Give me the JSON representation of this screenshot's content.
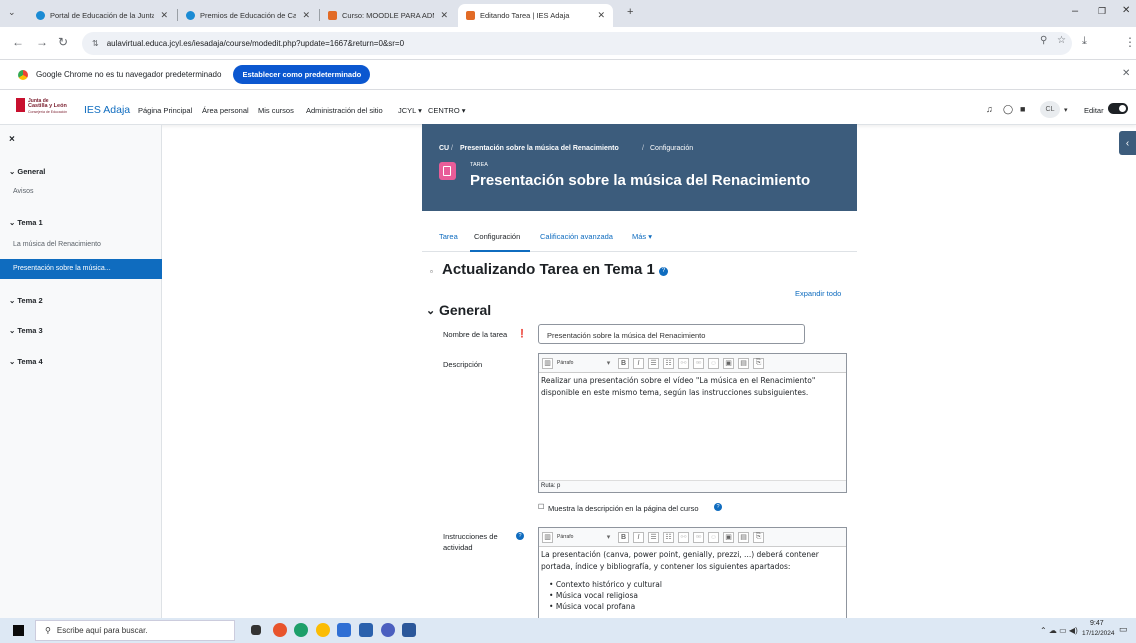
{
  "browser": {
    "tabs": [
      {
        "title": "Portal de Educación de la Junta",
        "active": false
      },
      {
        "title": "Premios de Educación de Castil",
        "active": false
      },
      {
        "title": "Curso: MOODLE PARA ADMINI",
        "active": false
      },
      {
        "title": "Editando Tarea | IES Adaja",
        "active": true
      }
    ],
    "url": "aulavirtual.educa.jcyl.es/iesadaja/course/modedit.php?update=1667&return=0&sr=0",
    "infobar_text": "Google Chrome no es tu navegador predeterminado",
    "infobar_button": "Establecer como predeterminado"
  },
  "moodle": {
    "site_name": "IES Adaja",
    "logo_text_1": "Junta de",
    "logo_text_2": "Castilla y León",
    "logo_text_3": "Consejería de Educación",
    "menu": [
      "Página Principal",
      "Área personal",
      "Mis cursos",
      "Administración del sitio",
      "JCYL ▾",
      "CENTRO ▾"
    ],
    "user_initials": "CL",
    "edit_label": "Editar"
  },
  "drawer": {
    "close": "×",
    "sections": [
      {
        "title": "General",
        "items": [
          "Avisos"
        ]
      },
      {
        "title": "Tema 1",
        "items": [
          "La música del Renacimiento",
          "Presentación sobre la música..."
        ]
      },
      {
        "title": "Tema 2",
        "items": []
      },
      {
        "title": "Tema 3",
        "items": []
      },
      {
        "title": "Tema 4",
        "items": []
      }
    ]
  },
  "header": {
    "breadcrumb_course": "CU",
    "breadcrumb_activity": "Presentación sobre la música del Renacimiento",
    "breadcrumb_current": "Configuración",
    "type_label": "TAREA",
    "title": "Presentación sobre la música del Renacimiento"
  },
  "tabs": [
    "Tarea",
    "Configuración",
    "Calificación avanzada",
    "Más ▾"
  ],
  "form": {
    "page_title": "Actualizando Tarea en Tema 1",
    "expand_all": "Expandir todo",
    "section_general": "General",
    "name_label": "Nombre de la tarea",
    "name_value": "Presentación sobre la música del Renacimiento",
    "description_label": "Descripción",
    "paragraph_select": "Párrafo",
    "description_text": "Realizar una presentación sobre el vídeo \"La música en el Renacimiento\" disponible en este mismo tema, según las instrucciones subsiguientes.",
    "path_label": "Ruta: p",
    "show_description": "Muestra la descripción en la página del curso",
    "instructions_label_1": "Instrucciones de",
    "instructions_label_2": "actividad",
    "instructions_text": "La presentación (canva, power point, genially, prezzi, ...) deberá contener portada, índice y bibliografía, y contener los siguientes apartados:",
    "instructions_list": [
      "Contexto histórico y cultural",
      "Música vocal religiosa",
      "Música vocal profana"
    ]
  },
  "taskbar": {
    "search_placeholder": "Escribe aquí para buscar.",
    "time": "9:47",
    "date": "17/12/2024"
  },
  "colors": {
    "brand": "#0f6cbf",
    "header_bg": "#3c5c7c",
    "task_icon": "#e85d99"
  }
}
